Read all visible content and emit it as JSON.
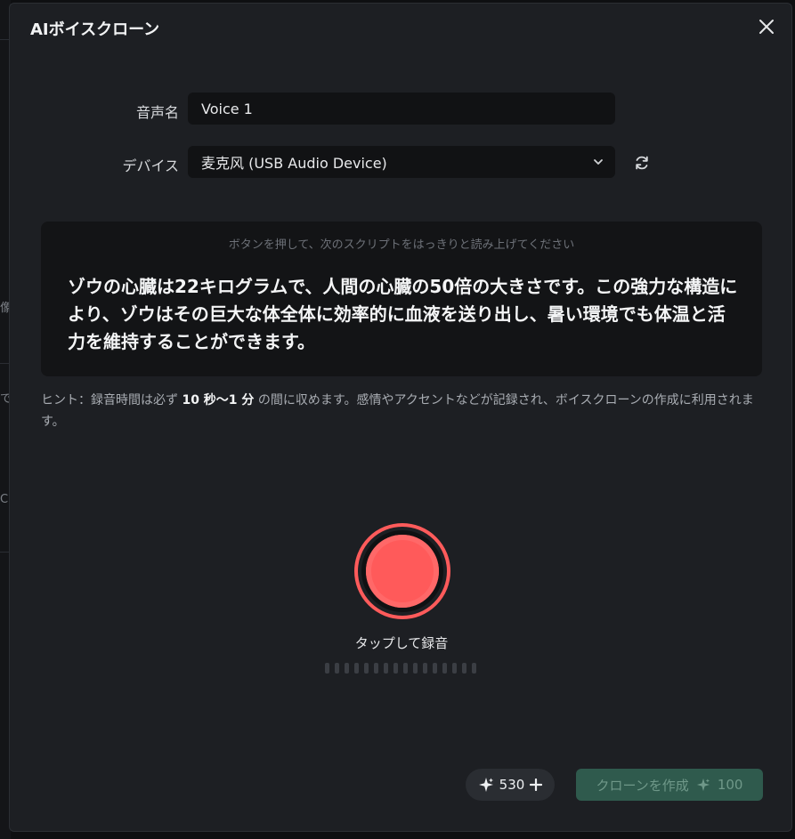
{
  "background": {
    "fragments": [
      "像",
      "で",
      "C"
    ]
  },
  "dialog": {
    "title": "AIボイスクローン",
    "close_icon": "close-icon"
  },
  "form": {
    "voice_name_label": "音声名",
    "voice_name_value": "Voice 1",
    "device_label": "デバイス",
    "device_value": "麦克风 (USB Audio Device)",
    "refresh_icon": "refresh-icon"
  },
  "script": {
    "hint": "ボタンを押して、次のスクリプトをはっきりと読み上げてください",
    "text": "ゾウの心臓は22キログラムで、人間の心臓の50倍の大きさです。この強力な構造により、ゾウはその巨大な体全体に効率的に血液を送り出し、暑い環境でも体温と活力を維持することができます。"
  },
  "tip": {
    "prefix": "ヒント：録音時間は必ず",
    "emphasis": "10 秒〜1 分",
    "suffix": "の間に収めます。感情やアクセントなどが記録され、ボイスクローンの作成に利用されます。"
  },
  "recorder": {
    "label": "タップして録音"
  },
  "footer": {
    "credits": "530",
    "clone_label": "クローンを作成",
    "clone_cost": "100"
  },
  "colors": {
    "accent_record": "#ff5b5b",
    "clone_button": "#2f5a4d",
    "dialog_bg": "#1d1f23"
  }
}
